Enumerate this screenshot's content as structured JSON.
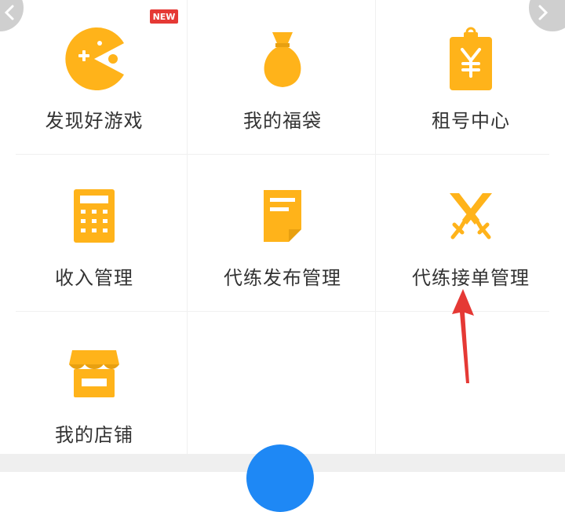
{
  "colors": {
    "accent": "#ffb31a",
    "badge": "#e53935",
    "text": "#333333",
    "fab": "#1e88f5",
    "annotation_arrow": "#e53935"
  },
  "badge": {
    "text": "NEW"
  },
  "menu": {
    "items": [
      {
        "label": "发现好游戏",
        "icon": "pacman-icon"
      },
      {
        "label": "我的福袋",
        "icon": "money-bag-icon"
      },
      {
        "label": "租号中心",
        "icon": "yuan-clipboard-icon"
      },
      {
        "label": "收入管理",
        "icon": "calculator-icon"
      },
      {
        "label": "代练发布管理",
        "icon": "document-icon"
      },
      {
        "label": "代练接单管理",
        "icon": "crossed-swords-icon"
      },
      {
        "label": "我的店铺",
        "icon": "storefront-icon"
      }
    ]
  }
}
